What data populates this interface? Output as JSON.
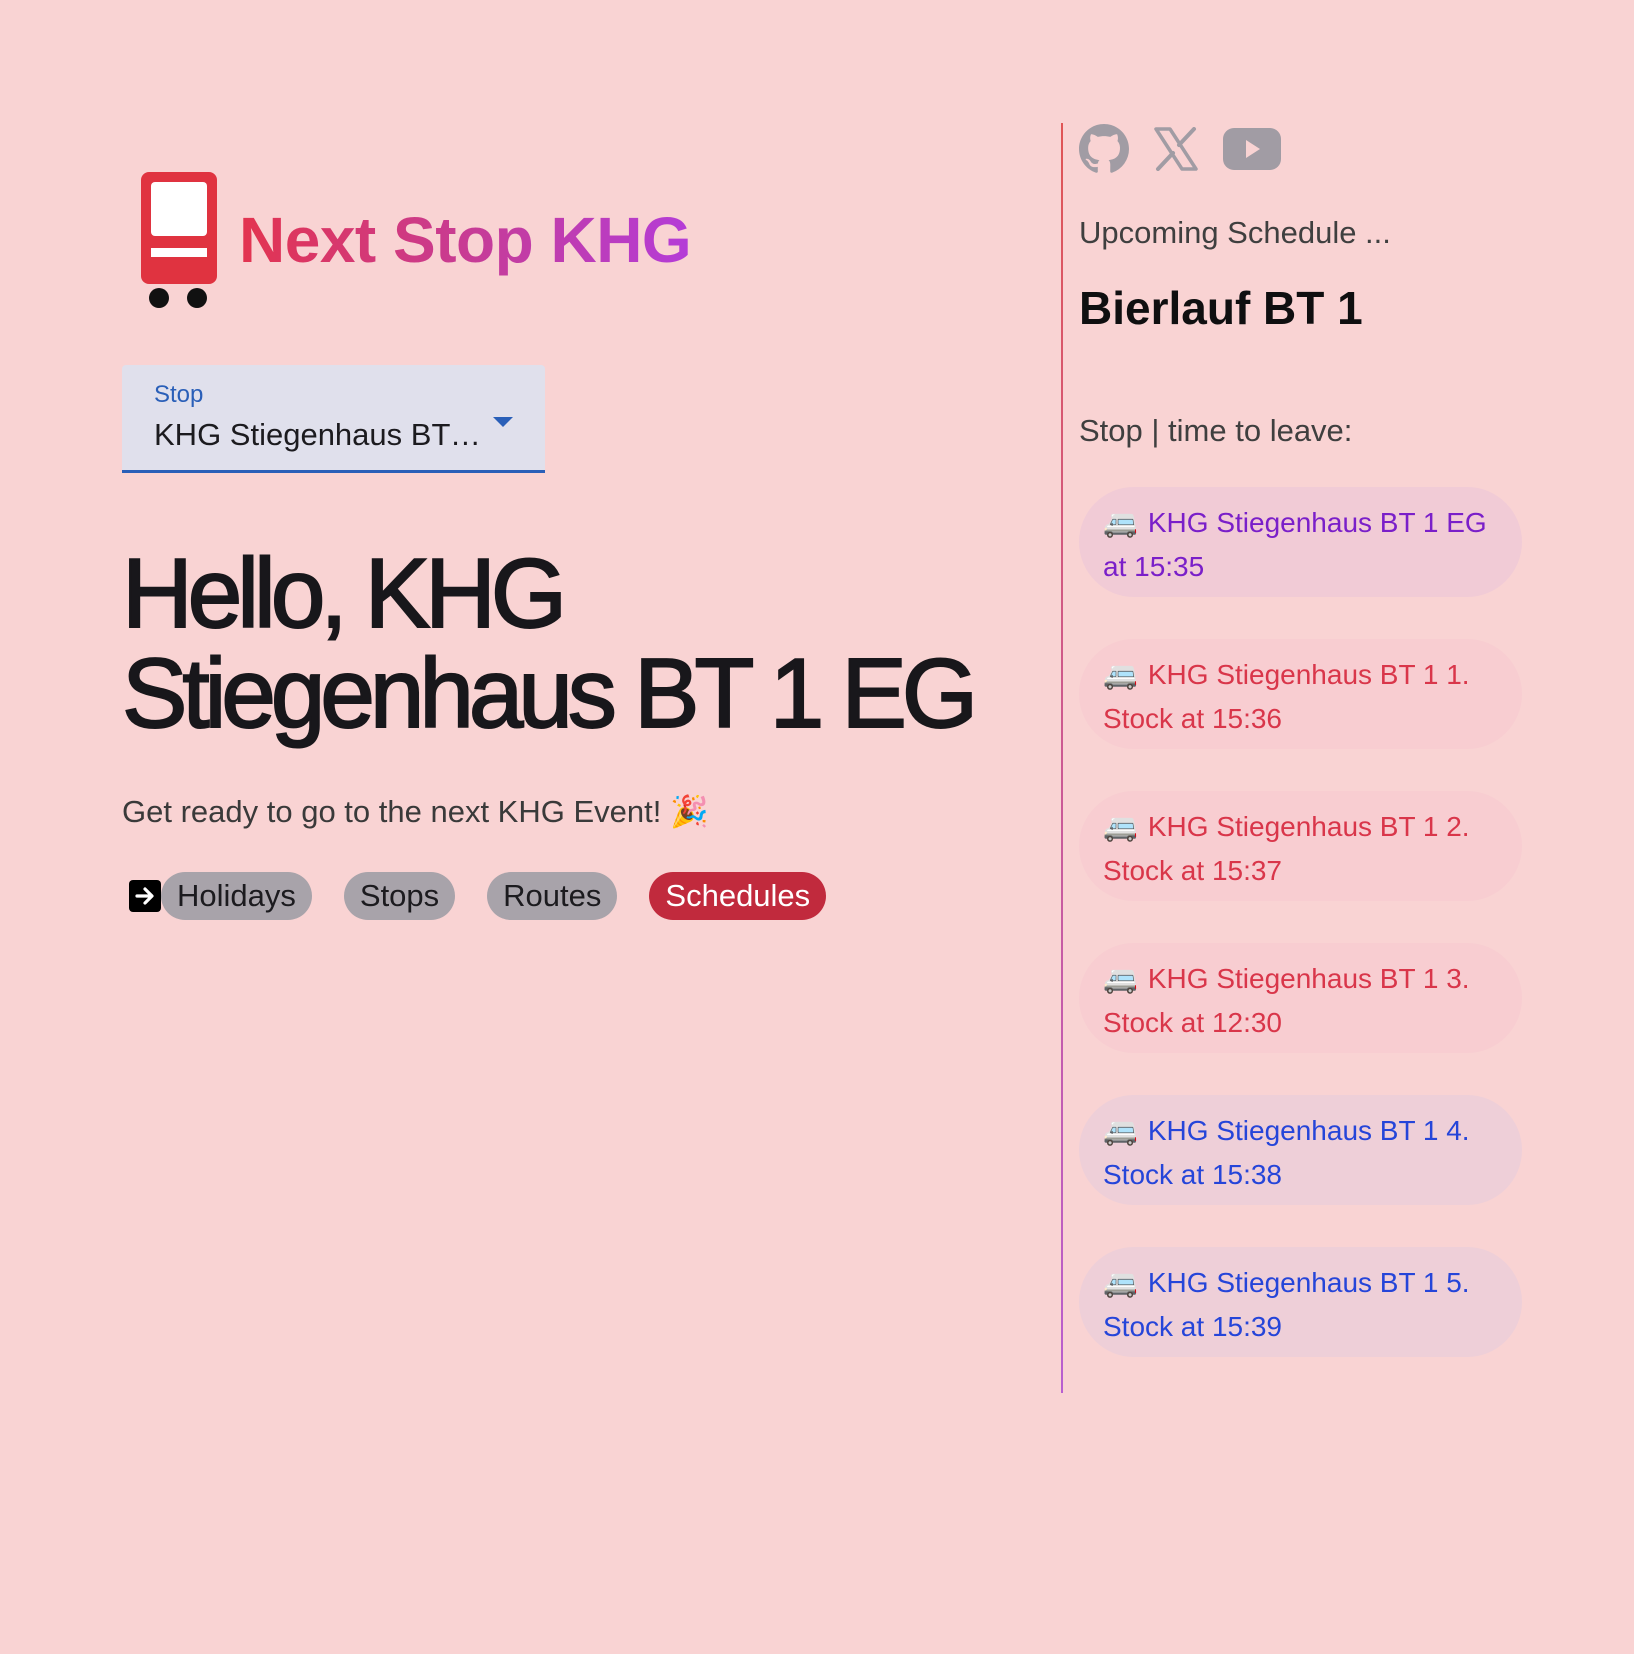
{
  "brand": {
    "title": "Next Stop KHG"
  },
  "stop_select": {
    "label": "Stop",
    "value": "KHG Stiegenhaus BT 1 EG"
  },
  "hello": {
    "line1": "Hello, KHG",
    "line2": "Stiegenhaus BT 1 EG"
  },
  "tagline": "Get ready to go to the next KHG Event! 🎉",
  "nav": {
    "holidays": "Holidays",
    "stops": "Stops",
    "routes": "Routes",
    "schedules": "Schedules",
    "active": "Schedules"
  },
  "sidebar": {
    "social_icons": [
      "github-icon",
      "x-icon",
      "youtube-icon"
    ],
    "upcoming_label": "Upcoming Schedule ...",
    "event_title": "Bierlauf BT 1",
    "stop_time_label": "Stop | time to leave:",
    "items": [
      {
        "icon": "🚐",
        "text": "KHG Stiegenhaus BT 1 EG at 15:35",
        "color": "#7a1fc9",
        "bg": "#f1cbd6"
      },
      {
        "icon": "🚐",
        "text": "KHG Stiegenhaus BT 1 1. Stock at 15:36",
        "color": "#d9364a",
        "bg": "#f8cdd1"
      },
      {
        "icon": "🚐",
        "text": "KHG Stiegenhaus BT 1 2. Stock at 15:37",
        "color": "#d9364a",
        "bg": "#f8cdd1"
      },
      {
        "icon": "🚐",
        "text": "KHG Stiegenhaus BT 1 3. Stock at 12:30",
        "color": "#d9364a",
        "bg": "#f8cdd1"
      },
      {
        "icon": "🚐",
        "text": "KHG Stiegenhaus BT 1 4. Stock at 15:38",
        "color": "#2545d9",
        "bg": "#eecfd8"
      },
      {
        "icon": "🚐",
        "text": "KHG Stiegenhaus BT 1 5. Stock at 15:39",
        "color": "#2545d9",
        "bg": "#eecfd8"
      }
    ]
  },
  "colors": {
    "background": "#f9d3d3",
    "accent_red": "#c12a3d",
    "select_blue": "#2a5fb8"
  }
}
